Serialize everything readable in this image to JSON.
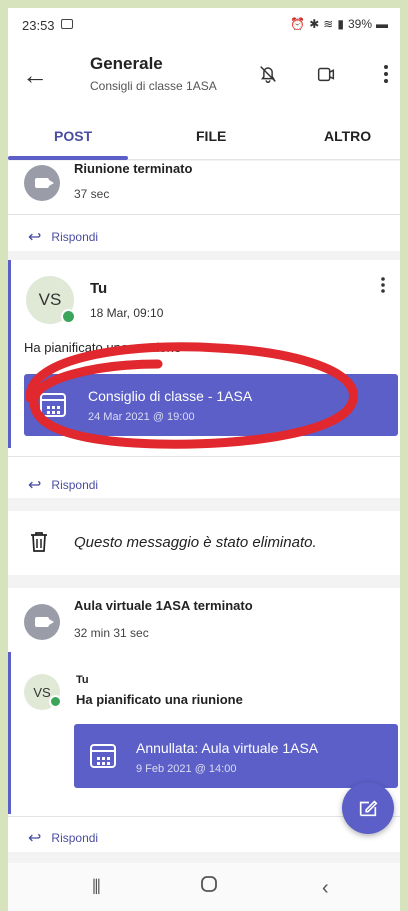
{
  "status_bar": {
    "time": "23:53",
    "battery": "39%"
  },
  "header": {
    "back_icon": "back-arrow-icon",
    "title": "Generale",
    "subtitle": "Consigli di classe 1ASA"
  },
  "tabs": [
    {
      "label": "POST",
      "active": true
    },
    {
      "label": "FILE",
      "active": false
    },
    {
      "label": "ALTRO",
      "active": false
    }
  ],
  "posts": {
    "first": {
      "title": "Riunione terminato",
      "duration": "37 sec",
      "reply": "Rispondi"
    },
    "second": {
      "avatar": "VS",
      "author": "Tu",
      "timestamp": "18 Mar, 09:10",
      "text_before": "Ha pianificato una",
      "text_after": "unione",
      "event_title": "Consiglio di classe - 1ASA",
      "event_time": "24 Mar 2021 @ 19:00",
      "reply": "Rispondi"
    },
    "deleted": {
      "text": "Questo messaggio è stato eliminato."
    },
    "third": {
      "title": "Aula virtuale 1ASA terminato",
      "duration": "32 min 31 sec",
      "avatar": "VS",
      "author": "Tu",
      "text": "Ha pianificato una riunione",
      "event_title": "Annullata: Aula virtuale 1ASA",
      "event_time": "9 Feb 2021 @ 14:00",
      "reply": "Rispondi"
    }
  },
  "colors": {
    "accent": "#5b5fc7",
    "annotation": "#e0282e",
    "frame": "#d7e3bd"
  }
}
